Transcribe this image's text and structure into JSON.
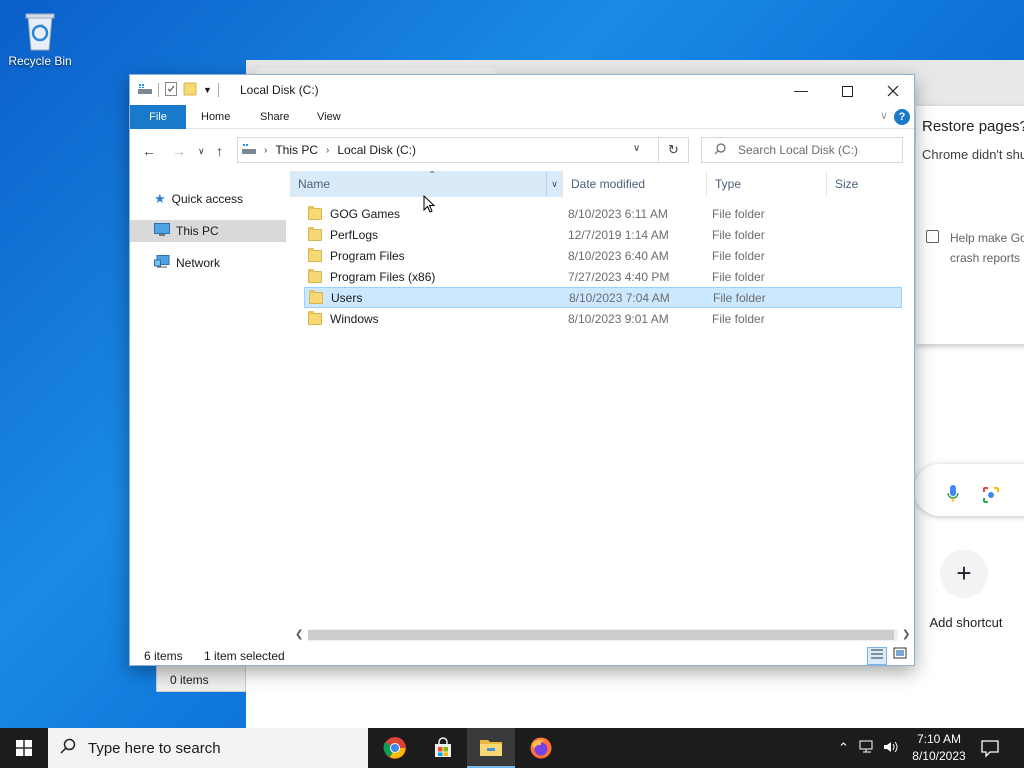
{
  "desktop": {
    "recycle_bin_label": "Recycle Bin"
  },
  "chrome_bg": {
    "restore_title": "Restore pages?",
    "restore_text": "Chrome didn't shu",
    "help_text_1": "Help make Go",
    "help_text_2": "crash reports a",
    "add_shortcut_label": "Add shortcut"
  },
  "behind_panel": {
    "items_label": "0 items"
  },
  "explorer": {
    "title": "Local Disk (C:)",
    "ribbon_tabs": [
      "File",
      "Home",
      "Share",
      "View"
    ],
    "breadcrumb": [
      "This PC",
      "Local Disk (C:)"
    ],
    "search_placeholder": "Search Local Disk (C:)",
    "nav_items": [
      {
        "label": "Quick access",
        "icon": "star-icon"
      },
      {
        "label": "This PC",
        "icon": "computer-icon",
        "selected": true
      },
      {
        "label": "Network",
        "icon": "network-icon"
      }
    ],
    "columns": [
      "Name",
      "Date modified",
      "Type",
      "Size"
    ],
    "rows": [
      {
        "name": "GOG Games",
        "date": "8/10/2023 6:11 AM",
        "type": "File folder",
        "selected": false
      },
      {
        "name": "PerfLogs",
        "date": "12/7/2019 1:14 AM",
        "type": "File folder",
        "selected": false
      },
      {
        "name": "Program Files",
        "date": "8/10/2023 6:40 AM",
        "type": "File folder",
        "selected": false
      },
      {
        "name": "Program Files (x86)",
        "date": "7/27/2023 4:40 PM",
        "type": "File folder",
        "selected": false
      },
      {
        "name": "Users",
        "date": "8/10/2023 7:04 AM",
        "type": "File folder",
        "selected": true
      },
      {
        "name": "Windows",
        "date": "8/10/2023 9:01 AM",
        "type": "File folder",
        "selected": false
      }
    ],
    "status_count": "6 items",
    "status_selected": "1 item selected"
  },
  "taskbar": {
    "search_placeholder": "Type here to search",
    "apps": [
      "chrome-icon",
      "store-icon",
      "file-explorer-icon",
      "firefox-icon"
    ],
    "time": "7:10 AM",
    "date": "8/10/2023"
  },
  "colors": {
    "accent": "#1979ca",
    "selection": "#cce8ff",
    "taskbar": "#1c1c1c"
  }
}
